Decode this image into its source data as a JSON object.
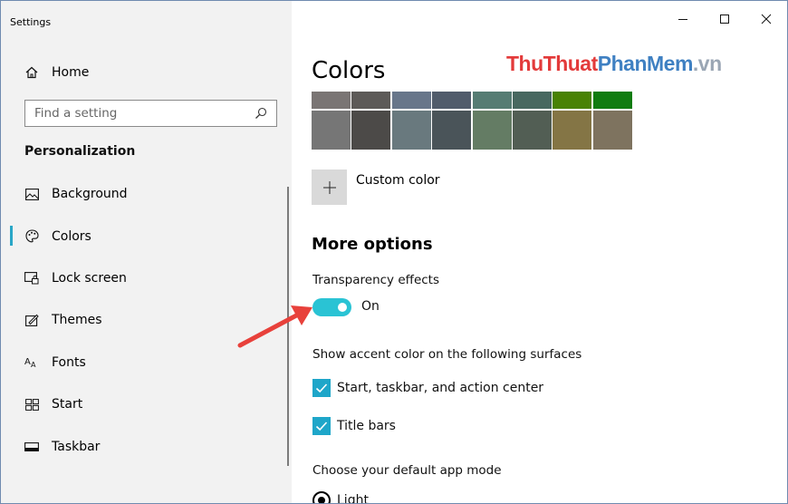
{
  "window": {
    "title": "Settings",
    "controls": {
      "minimize": "—",
      "maximize": "☐",
      "close": "✕"
    }
  },
  "sidebar": {
    "home_label": "Home",
    "search_placeholder": "Find a setting",
    "section_label": "Personalization",
    "items": [
      {
        "label": "Background",
        "icon": "image-icon",
        "active": false
      },
      {
        "label": "Colors",
        "icon": "palette-icon",
        "active": true
      },
      {
        "label": "Lock screen",
        "icon": "lock-screen-icon",
        "active": false
      },
      {
        "label": "Themes",
        "icon": "themes-icon",
        "active": false
      },
      {
        "label": "Fonts",
        "icon": "fonts-icon",
        "active": false
      },
      {
        "label": "Start",
        "icon": "start-icon",
        "active": false
      },
      {
        "label": "Taskbar",
        "icon": "taskbar-icon",
        "active": false
      }
    ]
  },
  "main": {
    "page_title": "Colors",
    "watermark": {
      "part1": "Thu",
      "part2": "Thuat",
      "part3": "PhanMem",
      "part4": ".vn"
    },
    "swatches": {
      "row1": [
        "#7a7574",
        "#5d5a58",
        "#68768a",
        "#515c6b",
        "#567c73",
        "#486860",
        "#498205",
        "#107c10"
      ],
      "row2": [
        "#767676",
        "#4c4a48",
        "#69797e",
        "#4a5459",
        "#647c64",
        "#525e54",
        "#847545",
        "#7e735f"
      ]
    },
    "custom_color_label": "Custom color",
    "more_options_heading": "More options",
    "transparency_label": "Transparency effects",
    "transparency_state": "On",
    "accent_surfaces_label": "Show accent color on the following surfaces",
    "checkboxes": [
      {
        "label": "Start, taskbar, and action center",
        "checked": true
      },
      {
        "label": "Title bars",
        "checked": true
      }
    ],
    "app_mode_label": "Choose your default app mode",
    "app_mode_option": "Light"
  },
  "colors": {
    "accent": "#2ac3d4",
    "checkbox": "#1ea6c9",
    "arrow": "#e8413b"
  }
}
